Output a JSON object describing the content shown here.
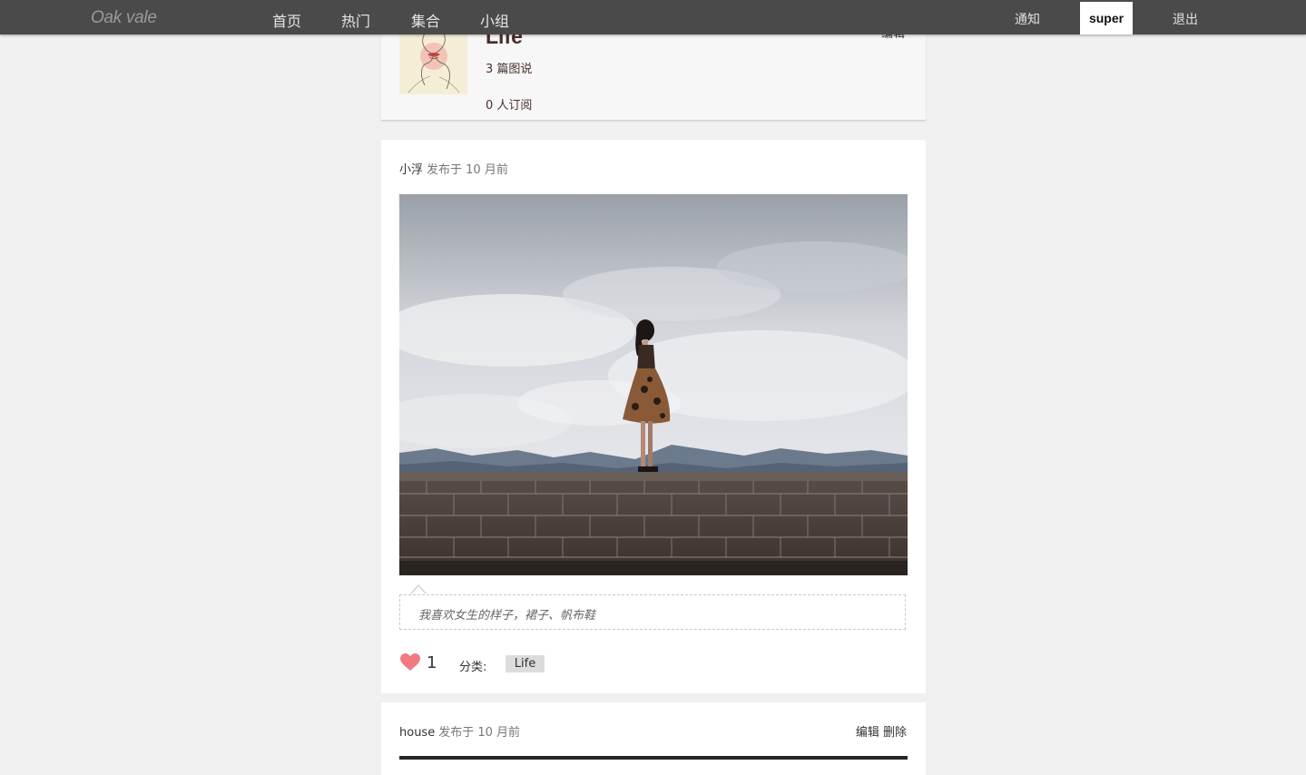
{
  "nav": {
    "brand": "Oak vale",
    "items": [
      "首页",
      "热门",
      "集合",
      "小组"
    ],
    "notifications": "通知",
    "username": "super",
    "logout": "退出"
  },
  "collection": {
    "title": "Life",
    "post_count": "3 篇图说",
    "subscribers": "0 人订阅",
    "edit": "编辑"
  },
  "posts": [
    {
      "author": "小浮",
      "time": "发布于 10 月前",
      "caption": "我喜欢女生的样子，裙子、帆布鞋",
      "likes": "1",
      "category_label": "分类:",
      "category": "Life"
    },
    {
      "author": "house",
      "time": "发布于 10 月前",
      "edit": "编辑",
      "delete": "删除"
    }
  ],
  "colors": {
    "topbar": "#4a4a4a",
    "heart": "#f07a80",
    "background": "#f0f0f0"
  }
}
